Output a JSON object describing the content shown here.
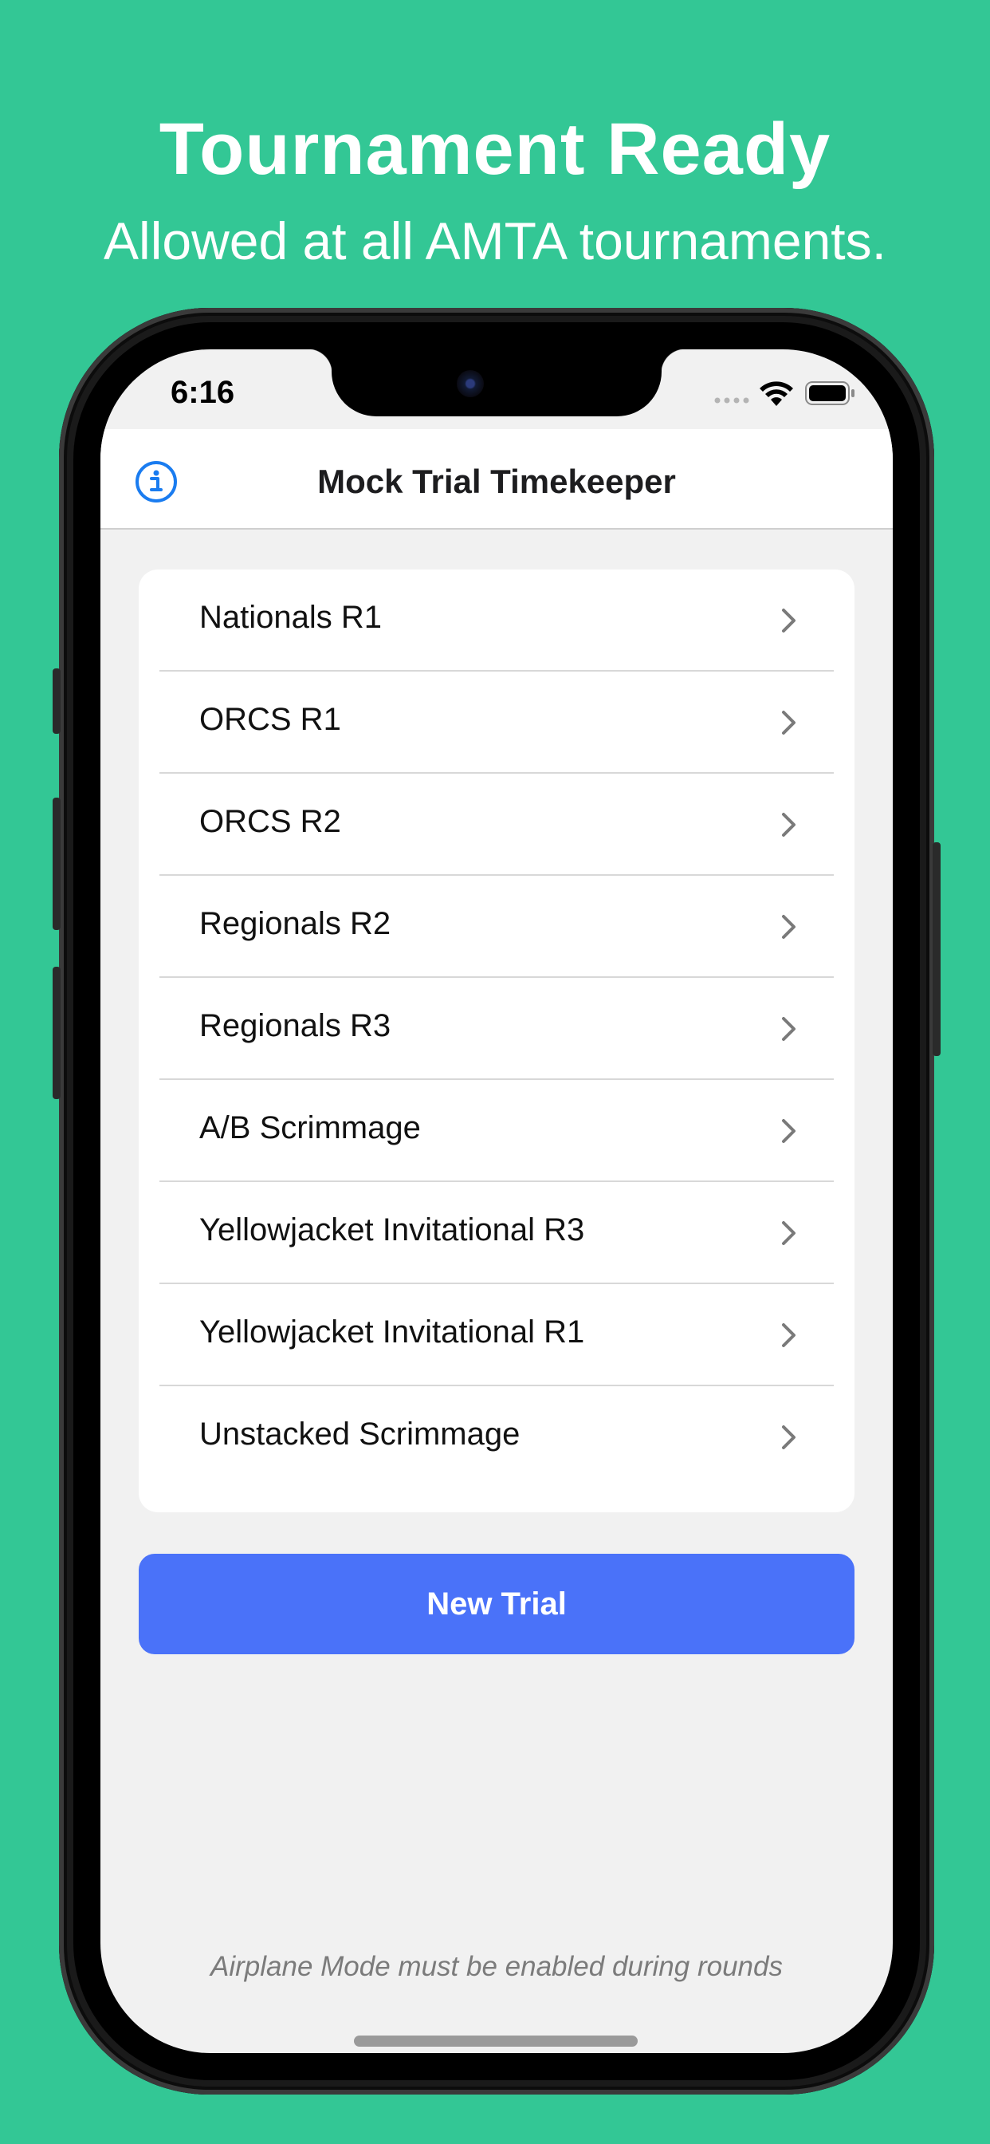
{
  "promo": {
    "headline": "Tournament Ready",
    "subhead": "Allowed at all AMTA tournaments."
  },
  "status_bar": {
    "time": "6:16",
    "icons": [
      "signal-icon",
      "wifi-icon",
      "battery-icon"
    ]
  },
  "navbar": {
    "title": "Mock Trial Timekeeper",
    "left_icon": "info-icon"
  },
  "trials": [
    {
      "label": "Nationals R1"
    },
    {
      "label": "ORCS R1"
    },
    {
      "label": "ORCS R2"
    },
    {
      "label": "Regionals R2"
    },
    {
      "label": "Regionals R3"
    },
    {
      "label": "A/B Scrimmage"
    },
    {
      "label": "Yellowjacket Invitational R3"
    },
    {
      "label": "Yellowjacket Invitational R1"
    },
    {
      "label": "Unstacked Scrimmage"
    }
  ],
  "actions": {
    "new_trial_label": "New Trial"
  },
  "footer": {
    "note": "Airplane Mode must be enabled during rounds"
  },
  "colors": {
    "background": "#33c795",
    "accent": "#4a72f9",
    "info_icon": "#1a7cf0"
  }
}
